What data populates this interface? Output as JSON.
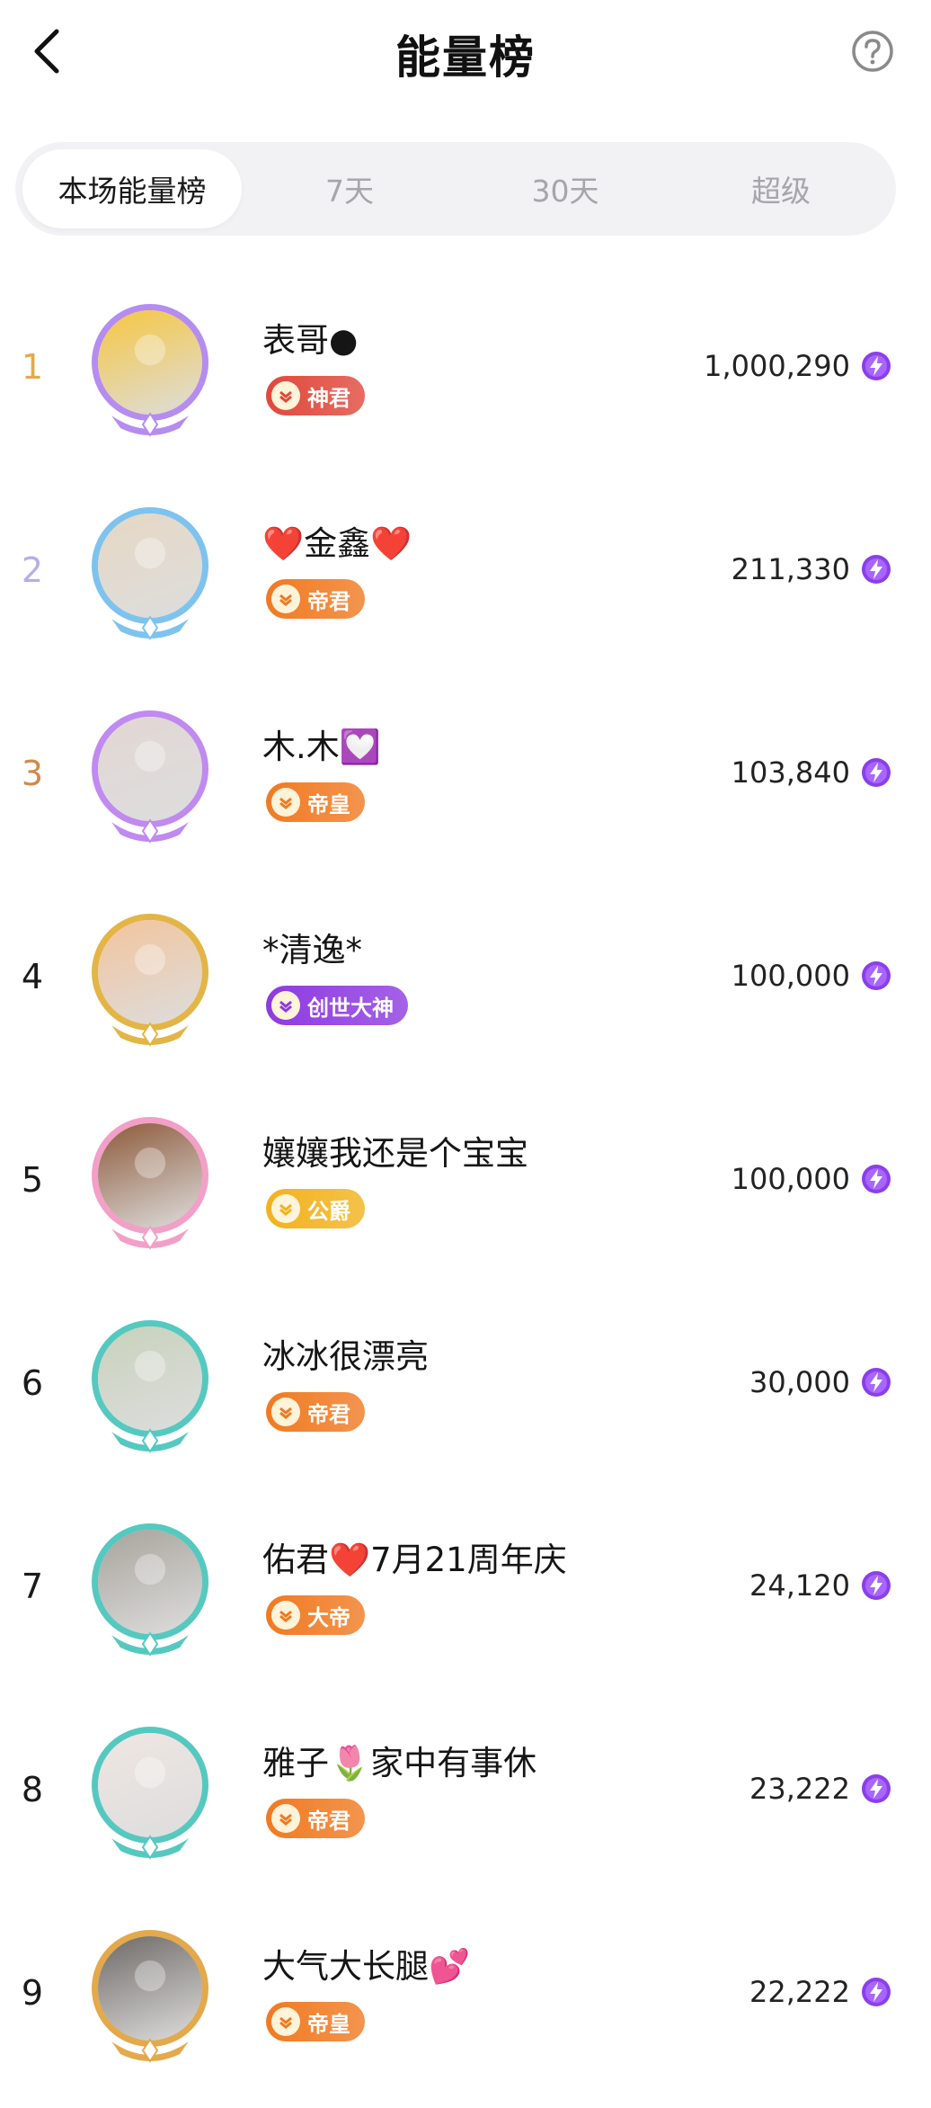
{
  "header": {
    "title": "能量榜"
  },
  "tabs": [
    {
      "label": "本场能量榜",
      "active": true
    },
    {
      "label": "7天",
      "active": false
    },
    {
      "label": "30天",
      "active": false
    },
    {
      "label": "超级",
      "active": false
    }
  ],
  "rank_colors": {
    "1": "#e3a94a",
    "2": "#b4aee8",
    "3": "#d08a4a",
    "default": "#1a1a1a"
  },
  "rows": [
    {
      "rank": "1",
      "name": "表哥●",
      "badge": "神君",
      "score": "1,000,290",
      "badge_color": "#e0483b",
      "ring": "#b58cf0",
      "avatar_bg": "#f6c741"
    },
    {
      "rank": "2",
      "name": "❤️金鑫❤️",
      "badge": "帝君",
      "score": "211,330",
      "badge_color": "#f07a22",
      "ring": "#7ec3ee",
      "avatar_bg": "#e6d8c4"
    },
    {
      "rank": "3",
      "name": "木.木💟",
      "badge": "帝皇",
      "score": "103,840",
      "badge_color": "#f07a22",
      "ring": "#c08af0",
      "avatar_bg": "#e2d7d3"
    },
    {
      "rank": "4",
      "name": "*清逸*",
      "badge": "创世大神",
      "score": "100,000",
      "badge_color": "#8e3ae0",
      "ring": "#e3b546",
      "avatar_bg": "#f2c49c"
    },
    {
      "rank": "5",
      "name": "孃孃我还是个宝宝",
      "badge": "公爵",
      "score": "100,000",
      "badge_color": "#f2b21e",
      "ring": "#f2a0c7",
      "avatar_bg": "#8d5a3a"
    },
    {
      "rank": "6",
      "name": "冰冰很漂亮",
      "badge": "帝君",
      "score": "30,000",
      "badge_color": "#f07a22",
      "ring": "#55c9c0",
      "avatar_bg": "#c8d2bc"
    },
    {
      "rank": "7",
      "name": "佑君❤️7月21周年庆",
      "badge": "大帝",
      "score": "24,120",
      "badge_color": "#f07a22",
      "ring": "#55c9c0",
      "avatar_bg": "#a8a49c"
    },
    {
      "rank": "8",
      "name": "雅子🌷家中有事休",
      "badge": "帝君",
      "score": "23,222",
      "badge_color": "#f07a22",
      "ring": "#55c9c0",
      "avatar_bg": "#efe6e2"
    },
    {
      "rank": "9",
      "name": "大气大长腿💕",
      "badge": "帝皇",
      "score": "22,222",
      "badge_color": "#f07a22",
      "ring": "#e3a94a",
      "avatar_bg": "#6f6a66"
    }
  ]
}
